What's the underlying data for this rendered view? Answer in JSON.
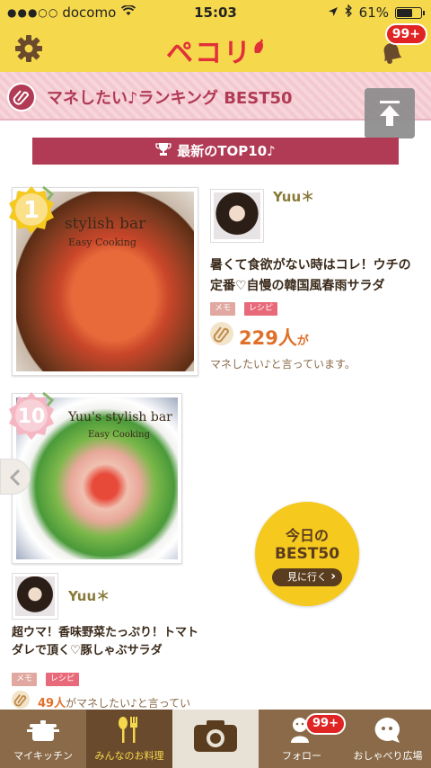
{
  "status_bar": {
    "signal": "●●●○○",
    "carrier": "docomo",
    "time": "15:03",
    "battery": "61%",
    "battery_level": 0.61
  },
  "header": {
    "logo": "ペコリ",
    "notifications_badge": "99+"
  },
  "ranking_header": {
    "title": "マネしたい♪ランキング BEST50"
  },
  "top10_banner": "最新のTOP10♪",
  "items": [
    {
      "rank": "1",
      "photo_text_1": "stylish bar",
      "photo_text_2": "Easy Cooking",
      "user": "Yuu＊",
      "description": "暑くて食欲がない時はコレ！ウチの定番♡自慢の韓国風春雨サラダ",
      "tags": [
        "メモ",
        "レシピ"
      ],
      "count": "229人",
      "count_suffix": "が",
      "say_text": "マネしたい♪と言っています。"
    },
    {
      "rank": "10",
      "photo_text_1": "Yuu's stylish bar",
      "photo_text_2": "Easy Cooking",
      "user": "Yuu＊",
      "description": "超ウマ！香味野菜たっぷり！トマトダレで頂く♡豚しゃぶサラダ",
      "tags": [
        "メモ",
        "レシピ"
      ],
      "count": "49人",
      "say_text": "がマネしたい♪と言ってい"
    }
  ],
  "best_button": {
    "line1": "今日の",
    "line2": "BEST50",
    "go": "見に行く"
  },
  "tabbar": {
    "tabs": [
      "マイキッチン",
      "みんなのお料理",
      "",
      "フォロー",
      "おしゃべり広場"
    ],
    "follow_badge": "99+",
    "active": "みんなのお料理"
  },
  "colors": {
    "header_yellow": "#f6d84c",
    "ranking_pink": "#b13a55",
    "count_orange": "#e0702a",
    "tabbar_brown": "#8a6a48"
  }
}
